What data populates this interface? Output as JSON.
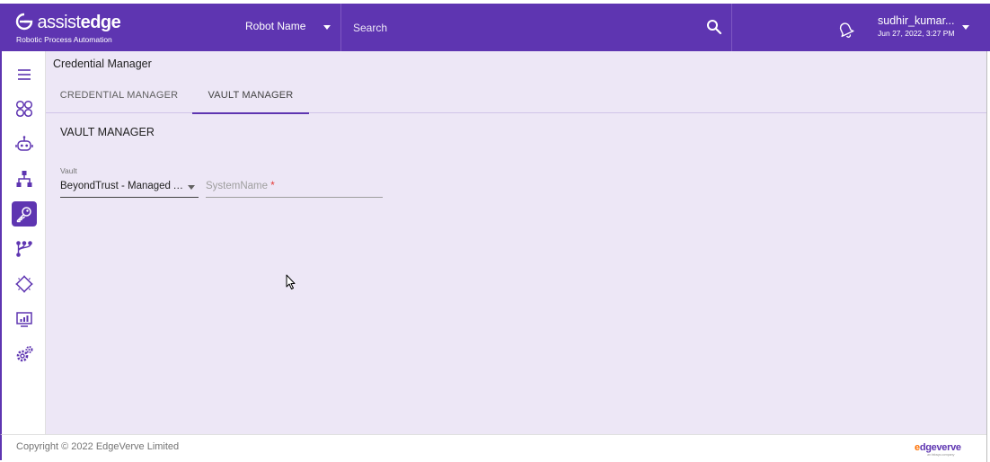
{
  "header": {
    "logo": {
      "word1": "assist",
      "word2": "edge",
      "subtitle": "Robotic Process Automation"
    },
    "robot_select": {
      "label": "Robot Name"
    },
    "search": {
      "placeholder": "Search"
    },
    "user": {
      "name": "sudhir_kumar...",
      "timestamp": "Jun 27, 2022, 3:27 PM"
    }
  },
  "sidebar": {
    "items": [
      {
        "icon": "menu-icon"
      },
      {
        "icon": "dashboard-grid-icon"
      },
      {
        "icon": "robot-icon"
      },
      {
        "icon": "hierarchy-icon"
      },
      {
        "icon": "key-icon",
        "active": true
      },
      {
        "icon": "workflow-branch-icon"
      },
      {
        "icon": "chip-icon"
      },
      {
        "icon": "monitor-chart-icon"
      },
      {
        "icon": "settings-gears-icon"
      }
    ]
  },
  "main": {
    "breadcrumb": "Credential Manager",
    "tabs": [
      {
        "label": "CREDENTIAL MANAGER",
        "active": false
      },
      {
        "label": "VAULT MANAGER",
        "active": true
      }
    ],
    "section_title": "VAULT MANAGER",
    "vault_field": {
      "label": "Vault",
      "value": "BeyondTrust - Managed Accounts"
    },
    "system_field": {
      "placeholder": "SystemName",
      "required_mark": "*"
    }
  },
  "footer": {
    "copyright": "Copyright © 2022 EdgeVerve Limited",
    "brand_e": "e",
    "brand_rest": "dgeverve",
    "brand_sub": "an Infosys company"
  },
  "colors": {
    "primary": "#5e35b1",
    "background": "#ede7f6",
    "accent_orange": "#ff6f00",
    "required": "#e53935"
  }
}
